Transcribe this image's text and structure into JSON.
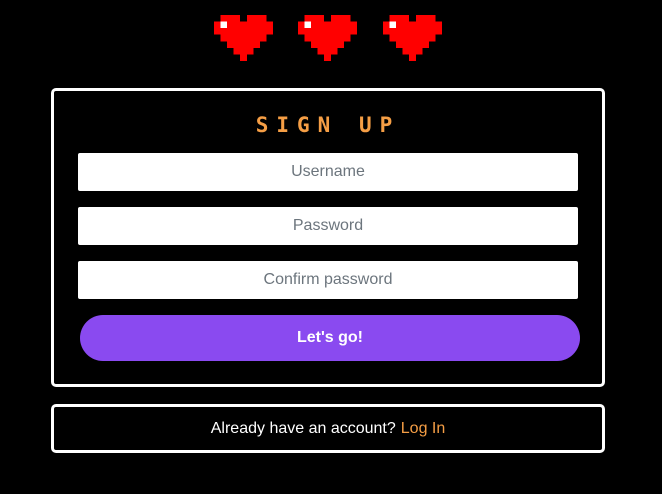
{
  "lives": {
    "count": 3,
    "heart_color": "#ff0000",
    "highlight_color": "#ffffff"
  },
  "signup": {
    "title": "SIGN UP",
    "username_placeholder": "Username",
    "password_placeholder": "Password",
    "confirm_placeholder": "Confirm password",
    "submit_label": "Let's go!"
  },
  "login": {
    "prompt": "Already have an account?",
    "link_label": "Log In"
  },
  "colors": {
    "accent": "#f59e45",
    "button": "#8a4af0",
    "background": "#000000",
    "border": "#ffffff"
  }
}
